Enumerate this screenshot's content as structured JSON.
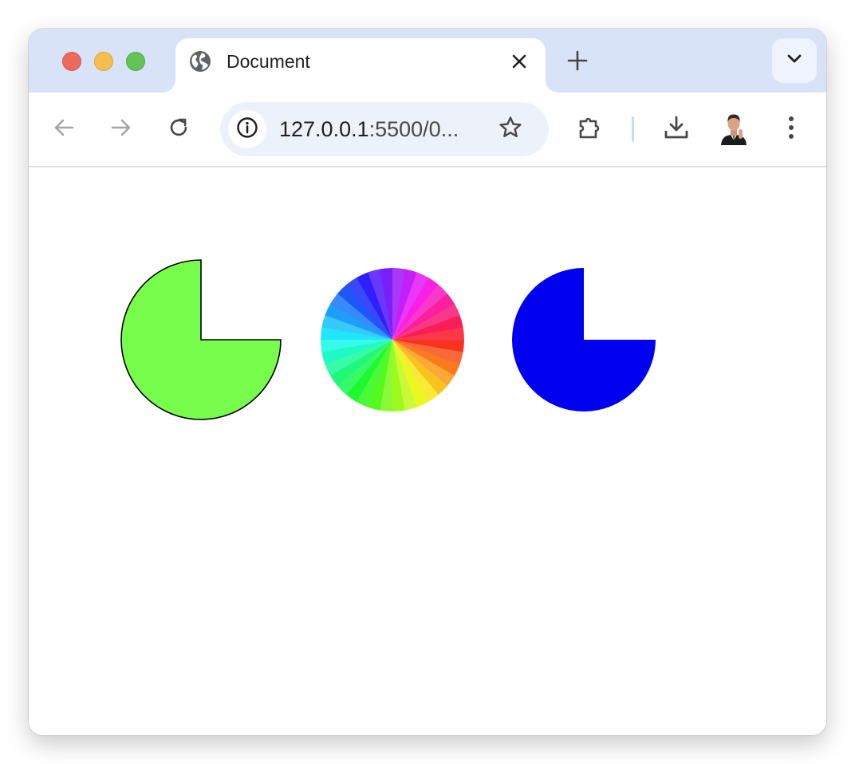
{
  "window": {
    "controls": [
      "close",
      "minimize",
      "zoom"
    ]
  },
  "tab": {
    "title": "Document",
    "favicon": "globe-icon",
    "close_icon": "close-icon"
  },
  "tabstrip": {
    "new_tab_icon": "plus-icon",
    "tab_search_icon": "chevron-down-icon"
  },
  "toolbar": {
    "back_icon": "arrow-left-icon",
    "forward_icon": "arrow-right-icon",
    "reload_icon": "reload-icon",
    "site_info_icon": "info-icon",
    "url_host": "127.0.0.1",
    "url_rest": ":5500/0...",
    "bookmark_icon": "star-icon",
    "extensions_icon": "puzzle-icon",
    "download_icon": "download-icon",
    "profile": "avatar",
    "menu_icon": "more-vert-icon"
  },
  "content": {
    "shapes": [
      {
        "name": "green-pie",
        "type": "three-quarter-circle",
        "fill": "#77fd4b",
        "stroke": "#000000"
      },
      {
        "name": "color-wheel",
        "type": "hue-wheel",
        "segments": 36
      },
      {
        "name": "blue-pie",
        "type": "three-quarter-circle",
        "fill": "#0000f0"
      }
    ]
  },
  "colors": {
    "tabstrip_bg": "#d8e3f8",
    "omnibox_bg": "#edf2fa",
    "icon": "#474747",
    "icon_disabled": "#a5a5a5"
  }
}
